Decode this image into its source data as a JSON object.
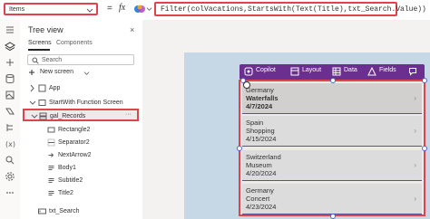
{
  "formula_bar": {
    "property": "Items",
    "equals": "=",
    "fx": "fx",
    "formula": "Filter(colVacations,StartsWith(Text(Title),txt_Search.Value))"
  },
  "tree": {
    "title": "Tree view",
    "close": "×",
    "tabs": {
      "screens": "Screens",
      "components": "Components"
    },
    "search_placeholder": "Search",
    "new_screen": "New screen",
    "rows": {
      "app": "App",
      "screen": "StartWith Function Screen",
      "gallery": "gal_Records",
      "rect": "Rectangle2",
      "sep": "Separator2",
      "next": "NextArrow2",
      "body": "Body1",
      "subtitle": "Subtitle2",
      "title": "Title2",
      "search": "txt_Search"
    },
    "gallery_more": "···"
  },
  "toolbar": {
    "copilot": "Copilot",
    "layout": "Layout",
    "data": "Data",
    "fields": "Fields"
  },
  "gallery": {
    "items": [
      {
        "country": "Germany",
        "title": "Waterfalls",
        "date": "4/7/2024"
      },
      {
        "country": "Spain",
        "title": "Shopping",
        "date": "4/15/2024"
      },
      {
        "country": "Switzerland",
        "title": "Museum",
        "date": "4/20/2024"
      },
      {
        "country": "Germany",
        "title": "Concert",
        "date": "4/23/2024"
      }
    ]
  },
  "colors": {
    "accent_red": "#e0424e",
    "toolbar_purple": "#6b2f8f",
    "selection_blue": "#5b5fc7"
  }
}
